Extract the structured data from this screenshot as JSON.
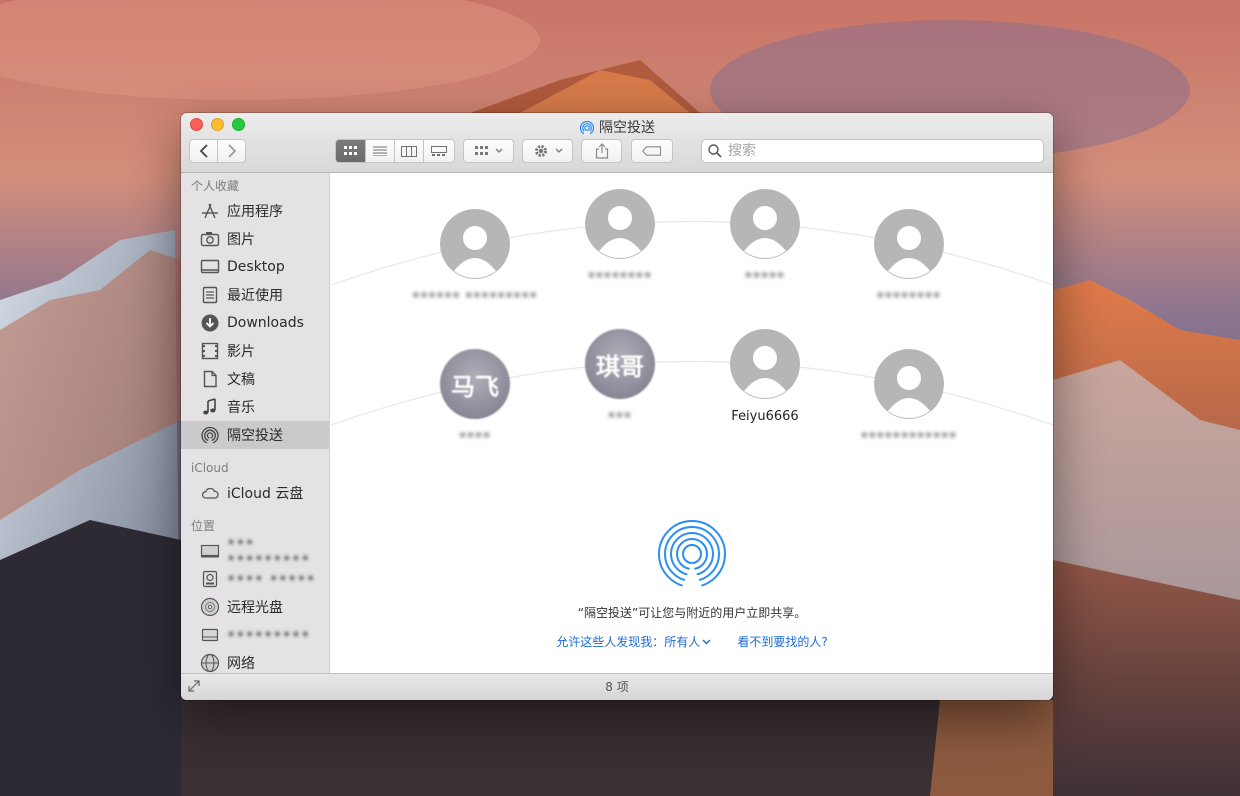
{
  "window": {
    "title": "隔空投送",
    "status": "8 项"
  },
  "toolbar": {
    "back_icon": "chevron-left-icon",
    "forward_icon": "chevron-right-icon",
    "views": [
      "icon-view-icon",
      "list-view-icon",
      "column-view-icon",
      "cover-flow-icon"
    ],
    "search_placeholder": "搜索"
  },
  "sidebar": {
    "favorites_header": "个人收藏",
    "favorites": [
      {
        "label": "应用程序",
        "icon": "applications-icon"
      },
      {
        "label": "图片",
        "icon": "camera-icon"
      },
      {
        "label": "Desktop",
        "icon": "desktop-icon"
      },
      {
        "label": "最近使用",
        "icon": "recents-icon"
      },
      {
        "label": "Downloads",
        "icon": "downloads-icon"
      },
      {
        "label": "影片",
        "icon": "movies-icon"
      },
      {
        "label": "文稿",
        "icon": "documents-icon"
      },
      {
        "label": "音乐",
        "icon": "music-icon"
      },
      {
        "label": "隔空投送",
        "icon": "airdrop-icon"
      }
    ],
    "icloud_header": "iCloud",
    "icloud": [
      {
        "label": "iCloud 云盘",
        "icon": "cloud-icon"
      }
    ],
    "locations_header": "位置",
    "locations": [
      {
        "label": "••• •••••••••",
        "icon": "computer-icon"
      },
      {
        "label": "•••• •••••",
        "icon": "disk-icon"
      },
      {
        "label": "远程光盘",
        "icon": "remote-disc-icon"
      },
      {
        "label": "•••••••••",
        "icon": "drive-icon"
      },
      {
        "label": "网络",
        "icon": "network-icon"
      }
    ]
  },
  "peers": [
    {
      "name": "•••••• •••••••••",
      "blurred": true,
      "initials": ""
    },
    {
      "name": "••••••••",
      "blurred": true,
      "initials": ""
    },
    {
      "name": "•••••",
      "blurred": true,
      "initials": ""
    },
    {
      "name": "••••••••",
      "blurred": true,
      "initials": ""
    },
    {
      "name": "••••",
      "blurred": true,
      "initials": "马飞"
    },
    {
      "name": "•••",
      "blurred": true,
      "initials": "琪哥"
    },
    {
      "name": "Feiyu6666",
      "blurred": false,
      "initials": ""
    },
    {
      "name": "••••••••••••",
      "blurred": true,
      "initials": ""
    }
  ],
  "airdrop": {
    "description": "“隔空投送”可让您与附近的用户立即共享。",
    "allow_label": "允许这些人发现我：所有人",
    "help_link": "看不到要找的人?"
  },
  "colors": {
    "link": "#1b6bd8",
    "airdrop_blue": "#2b8ef0",
    "sidebar_bg": "#e4e2e5"
  }
}
